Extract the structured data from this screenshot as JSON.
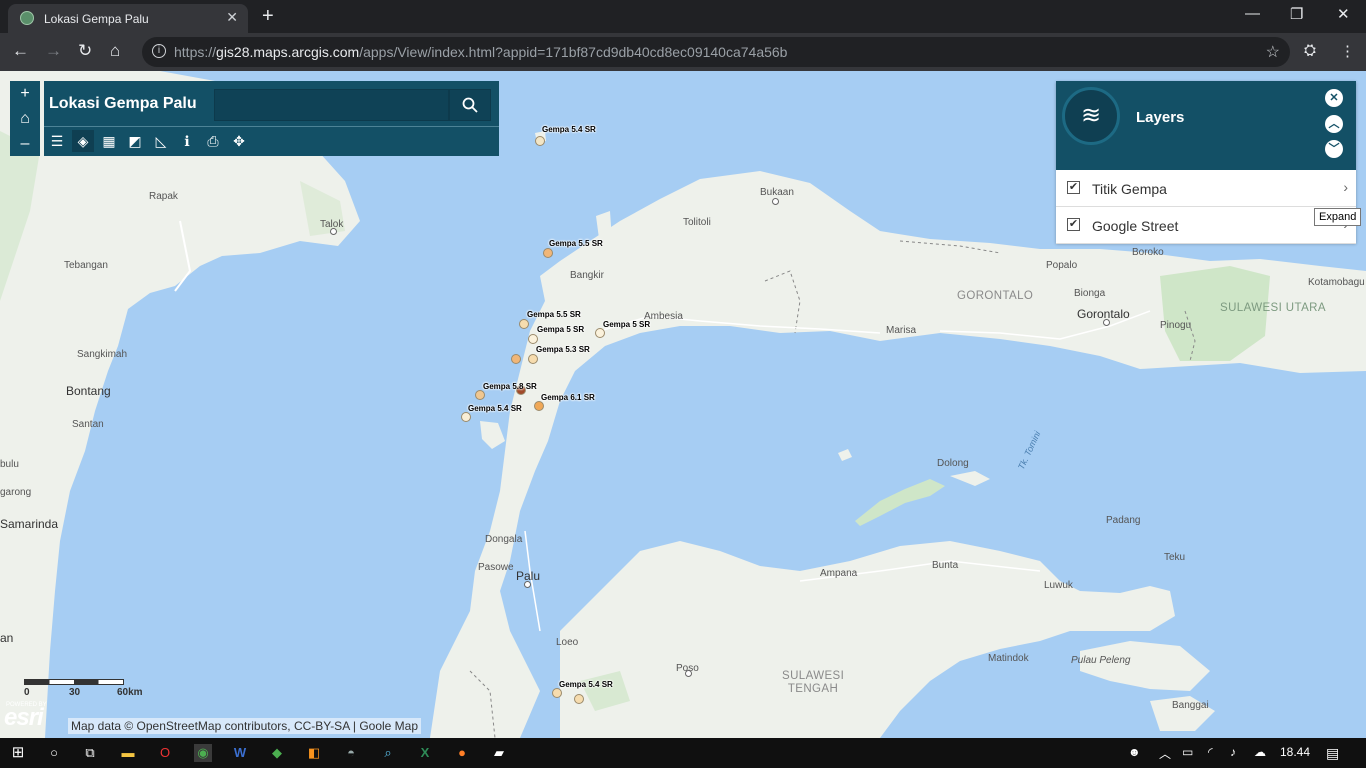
{
  "browser": {
    "tab_title": "Lokasi Gempa Palu",
    "tab_close": "✕",
    "new_tab": "+",
    "url_prefix": "https://",
    "url_host": "gis28.maps.arcgis.com",
    "url_path": "/apps/View/index.html?appid=171bf87cd9db40cd8ec09140ca74a56b",
    "window_controls": {
      "minimize": "—",
      "restore": "❐",
      "close": "✕"
    },
    "nav": {
      "back": "←",
      "forward": "→",
      "reload": "↻",
      "home": "⌂"
    }
  },
  "app": {
    "title": "Lokasi Gempa Palu",
    "search_placeholder": "",
    "zoom": {
      "in": "+",
      "home": "⌂",
      "out": "–"
    },
    "tools": [
      "list-icon",
      "layers-icon",
      "basemap-icon",
      "legend-icon",
      "measure-icon",
      "info-icon",
      "print-icon",
      "locate-icon"
    ],
    "tool_glyphs": [
      "☰",
      "◈",
      "▦",
      "◩",
      "◺",
      "ℹ",
      "⎙",
      "✥"
    ]
  },
  "layers_panel": {
    "title": "Layers",
    "glyph": "≋",
    "close": "✕",
    "up": "︿",
    "down": "﹀",
    "items": [
      {
        "name": "Titik Gempa",
        "checked": true
      },
      {
        "name": "Google Street",
        "checked": true
      }
    ],
    "tooltip": "Expand"
  },
  "map": {
    "places": [
      {
        "name": "Bukaan"
      },
      {
        "name": "Tolitoli"
      },
      {
        "name": "Talok"
      },
      {
        "name": "Rapak"
      },
      {
        "name": "Tebangan"
      },
      {
        "name": "Bangkir"
      },
      {
        "name": "Ambesia"
      },
      {
        "name": "Sangkimah"
      },
      {
        "name": "Bontang"
      },
      {
        "name": "Santan"
      },
      {
        "name": "bulu"
      },
      {
        "name": "garong"
      },
      {
        "name": "Samarinda"
      },
      {
        "name": "an"
      },
      {
        "name": "Dongala"
      },
      {
        "name": "Pasowe"
      },
      {
        "name": "Palu"
      },
      {
        "name": "Loeo"
      },
      {
        "name": "Poso"
      },
      {
        "name": "Ampana"
      },
      {
        "name": "Bunta"
      },
      {
        "name": "Luwuk"
      },
      {
        "name": "Matindok"
      },
      {
        "name": "Pulau Peleng"
      },
      {
        "name": "Banggai"
      },
      {
        "name": "Padang"
      },
      {
        "name": "Teku"
      },
      {
        "name": "Dolong"
      },
      {
        "name": "Tk. Tomini"
      },
      {
        "name": "Marisa"
      },
      {
        "name": "GORONTALO"
      },
      {
        "name": "Popalo"
      },
      {
        "name": "Bionga"
      },
      {
        "name": "Gorontalo"
      },
      {
        "name": "Pinogu"
      },
      {
        "name": "Boroko"
      },
      {
        "name": "SULAWESI UTARA"
      },
      {
        "name": "Kotamobagu"
      },
      {
        "name": "SULAWESI TENGAH"
      }
    ],
    "quakes": [
      {
        "label": "Gempa 5.4 SR",
        "color": "#f3e6c6"
      },
      {
        "label": "Gempa 5.5 SR",
        "color": "#f0b678"
      },
      {
        "label": "Gempa 5.5 SR",
        "color": "#f6dcae"
      },
      {
        "label": "Gempa 5 SR",
        "color": "#fbf2dc"
      },
      {
        "label": "Gempa 5 SR",
        "color": "#fbf2dc"
      },
      {
        "label": "Gempa 5.3 SR",
        "color": "#f6dcae"
      },
      {
        "label": "",
        "color": "#f0b678"
      },
      {
        "label": "Gempa 5.8 SR",
        "color": "#a14a2a"
      },
      {
        "label": "Gempa 6.1 SR",
        "color": "#f0a857"
      },
      {
        "label": "",
        "color": "#f0c790"
      },
      {
        "label": "Gempa 5.4 SR",
        "color": "#f9eed6"
      },
      {
        "label": "Gempa 5.4 SR",
        "color": "#f6dcae"
      },
      {
        "label": "",
        "color": "#f6dcae"
      }
    ],
    "scale": {
      "start": "0",
      "mid": "30",
      "end": "60km"
    },
    "powered_by": "POWERED BY",
    "esri": "esri",
    "attribution": "Map data © OpenStreetMap contributors, CC-BY-SA | Goole Map"
  },
  "taskbar": {
    "time": "18.44",
    "apps": [
      "windows-start",
      "cortana",
      "task-view",
      "file-explorer",
      "opera",
      "chrome",
      "word",
      "app-green",
      "app-orange",
      "app-gray",
      "app-search",
      "excel",
      "firefox",
      "app-white"
    ]
  }
}
